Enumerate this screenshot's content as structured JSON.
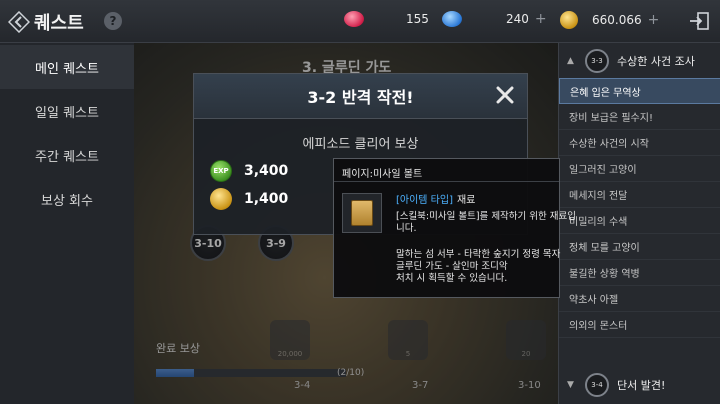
{
  "header": {
    "title": "퀘스트",
    "currency_red": "155",
    "currency_blue": "240",
    "gold": "660.066",
    "help_label": "?"
  },
  "sidebar": {
    "items": [
      {
        "label": "메인 퀘스트"
      },
      {
        "label": "일일 퀘스트"
      },
      {
        "label": "주간 퀘스트"
      },
      {
        "label": "보상 회수"
      }
    ]
  },
  "map": {
    "chapter_title": "3. 글루딘 가도",
    "nodes": [
      "3-10",
      "3-9"
    ],
    "bottom_labels": [
      "3-4",
      "3-7",
      "3-10"
    ],
    "reward_captions": [
      "20,000",
      "5",
      "20"
    ],
    "completion_label": "완료 보상",
    "progress_text": "(2/10)",
    "progress_fraction": 0.2
  },
  "right_panel": {
    "section1_badge": "3-3",
    "section1_title": "수상한 사건 조사",
    "items": [
      "은혜 입은 무역상",
      "장비 보급은 필수지!",
      "수상한 사건의 시작",
      "일그러진 고양이",
      "메세지의 전달",
      "비밀리의 수색",
      "정체 모를 고양이",
      "불길한 상황 역병",
      "약초사 아젤",
      "의외의 몬스터"
    ],
    "section2_badge": "3-4",
    "section2_title": "단서 발견!"
  },
  "dialog": {
    "title": "3-2 반격 작전!",
    "subtitle": "에피소드 클리어 보상",
    "exp_icon_text": "EXP",
    "exp_value": "3,400",
    "gold_value": "1,400"
  },
  "tooltip": {
    "title": "페이지:미사일 볼트",
    "type_tag": "[아이템 타입]",
    "type_value": "재료",
    "desc": "[스킬북:미사일 볼트]를 제작하기 위한 재료입\n니다.",
    "drop": "말하는 섬 서부 - 타락한 숲지기 정령 목자\n글루딘 가도 - 살인마 조디악\n처치 시 획득할 수 있습니다."
  }
}
